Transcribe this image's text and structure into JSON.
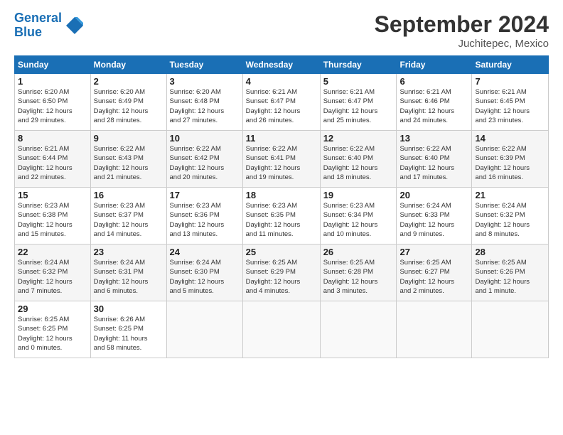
{
  "header": {
    "logo_line1": "General",
    "logo_line2": "Blue",
    "title": "September 2024",
    "subtitle": "Juchitepec, Mexico"
  },
  "days_of_week": [
    "Sunday",
    "Monday",
    "Tuesday",
    "Wednesday",
    "Thursday",
    "Friday",
    "Saturday"
  ],
  "weeks": [
    [
      {
        "day": "1",
        "info": "Sunrise: 6:20 AM\nSunset: 6:50 PM\nDaylight: 12 hours\nand 29 minutes."
      },
      {
        "day": "2",
        "info": "Sunrise: 6:20 AM\nSunset: 6:49 PM\nDaylight: 12 hours\nand 28 minutes."
      },
      {
        "day": "3",
        "info": "Sunrise: 6:20 AM\nSunset: 6:48 PM\nDaylight: 12 hours\nand 27 minutes."
      },
      {
        "day": "4",
        "info": "Sunrise: 6:21 AM\nSunset: 6:47 PM\nDaylight: 12 hours\nand 26 minutes."
      },
      {
        "day": "5",
        "info": "Sunrise: 6:21 AM\nSunset: 6:47 PM\nDaylight: 12 hours\nand 25 minutes."
      },
      {
        "day": "6",
        "info": "Sunrise: 6:21 AM\nSunset: 6:46 PM\nDaylight: 12 hours\nand 24 minutes."
      },
      {
        "day": "7",
        "info": "Sunrise: 6:21 AM\nSunset: 6:45 PM\nDaylight: 12 hours\nand 23 minutes."
      }
    ],
    [
      {
        "day": "8",
        "info": "Sunrise: 6:21 AM\nSunset: 6:44 PM\nDaylight: 12 hours\nand 22 minutes."
      },
      {
        "day": "9",
        "info": "Sunrise: 6:22 AM\nSunset: 6:43 PM\nDaylight: 12 hours\nand 21 minutes."
      },
      {
        "day": "10",
        "info": "Sunrise: 6:22 AM\nSunset: 6:42 PM\nDaylight: 12 hours\nand 20 minutes."
      },
      {
        "day": "11",
        "info": "Sunrise: 6:22 AM\nSunset: 6:41 PM\nDaylight: 12 hours\nand 19 minutes."
      },
      {
        "day": "12",
        "info": "Sunrise: 6:22 AM\nSunset: 6:40 PM\nDaylight: 12 hours\nand 18 minutes."
      },
      {
        "day": "13",
        "info": "Sunrise: 6:22 AM\nSunset: 6:40 PM\nDaylight: 12 hours\nand 17 minutes."
      },
      {
        "day": "14",
        "info": "Sunrise: 6:22 AM\nSunset: 6:39 PM\nDaylight: 12 hours\nand 16 minutes."
      }
    ],
    [
      {
        "day": "15",
        "info": "Sunrise: 6:23 AM\nSunset: 6:38 PM\nDaylight: 12 hours\nand 15 minutes."
      },
      {
        "day": "16",
        "info": "Sunrise: 6:23 AM\nSunset: 6:37 PM\nDaylight: 12 hours\nand 14 minutes."
      },
      {
        "day": "17",
        "info": "Sunrise: 6:23 AM\nSunset: 6:36 PM\nDaylight: 12 hours\nand 13 minutes."
      },
      {
        "day": "18",
        "info": "Sunrise: 6:23 AM\nSunset: 6:35 PM\nDaylight: 12 hours\nand 11 minutes."
      },
      {
        "day": "19",
        "info": "Sunrise: 6:23 AM\nSunset: 6:34 PM\nDaylight: 12 hours\nand 10 minutes."
      },
      {
        "day": "20",
        "info": "Sunrise: 6:24 AM\nSunset: 6:33 PM\nDaylight: 12 hours\nand 9 minutes."
      },
      {
        "day": "21",
        "info": "Sunrise: 6:24 AM\nSunset: 6:32 PM\nDaylight: 12 hours\nand 8 minutes."
      }
    ],
    [
      {
        "day": "22",
        "info": "Sunrise: 6:24 AM\nSunset: 6:32 PM\nDaylight: 12 hours\nand 7 minutes."
      },
      {
        "day": "23",
        "info": "Sunrise: 6:24 AM\nSunset: 6:31 PM\nDaylight: 12 hours\nand 6 minutes."
      },
      {
        "day": "24",
        "info": "Sunrise: 6:24 AM\nSunset: 6:30 PM\nDaylight: 12 hours\nand 5 minutes."
      },
      {
        "day": "25",
        "info": "Sunrise: 6:25 AM\nSunset: 6:29 PM\nDaylight: 12 hours\nand 4 minutes."
      },
      {
        "day": "26",
        "info": "Sunrise: 6:25 AM\nSunset: 6:28 PM\nDaylight: 12 hours\nand 3 minutes."
      },
      {
        "day": "27",
        "info": "Sunrise: 6:25 AM\nSunset: 6:27 PM\nDaylight: 12 hours\nand 2 minutes."
      },
      {
        "day": "28",
        "info": "Sunrise: 6:25 AM\nSunset: 6:26 PM\nDaylight: 12 hours\nand 1 minute."
      }
    ],
    [
      {
        "day": "29",
        "info": "Sunrise: 6:25 AM\nSunset: 6:25 PM\nDaylight: 12 hours\nand 0 minutes."
      },
      {
        "day": "30",
        "info": "Sunrise: 6:26 AM\nSunset: 6:25 PM\nDaylight: 11 hours\nand 58 minutes."
      },
      {
        "day": "",
        "info": ""
      },
      {
        "day": "",
        "info": ""
      },
      {
        "day": "",
        "info": ""
      },
      {
        "day": "",
        "info": ""
      },
      {
        "day": "",
        "info": ""
      }
    ]
  ]
}
